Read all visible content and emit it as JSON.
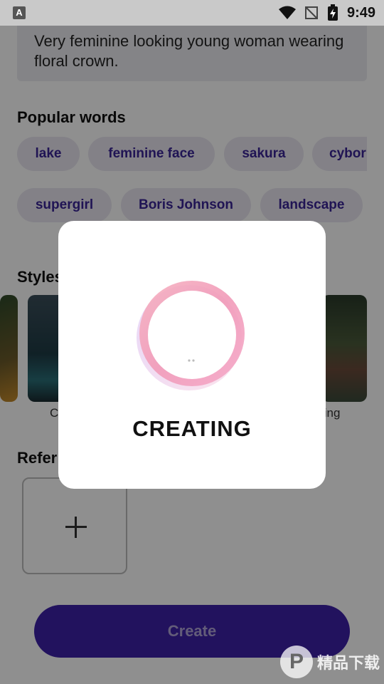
{
  "status": {
    "time": "9:49",
    "app_icon": "A",
    "icons": [
      "wifi-icon",
      "no-signal-icon",
      "battery-charging-icon"
    ]
  },
  "prompt": {
    "text": "Very feminine looking young woman wearing floral crown."
  },
  "popular_words": {
    "title": "Popular words",
    "chips": [
      "lake",
      "feminine face",
      "sakura",
      "cybor",
      "supergirl",
      "Boris Johnson",
      "landscape"
    ]
  },
  "styles": {
    "title": "Styles",
    "labels": [
      "C",
      "ting"
    ]
  },
  "reference": {
    "title": "Refer"
  },
  "create_button": {
    "label": "Create"
  },
  "dialog": {
    "label": "CREATING"
  },
  "watermark": {
    "text": "精品下载"
  },
  "colors": {
    "accent": "#3e20a8",
    "chip_text": "#3a2596",
    "chip_bg": "#e9e7f1"
  }
}
